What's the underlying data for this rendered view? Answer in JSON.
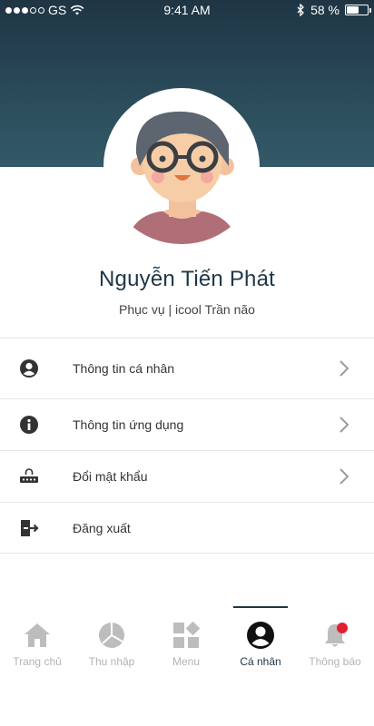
{
  "status_bar": {
    "carrier": "GS",
    "time": "9:41 AM",
    "battery": "58 %",
    "battery_level": 0.58,
    "icons": [
      "signal-dots",
      "wifi-icon",
      "bluetooth-icon",
      "battery-icon"
    ]
  },
  "profile": {
    "name": "Nguyễn Tiến Phát",
    "subtitle": "Phục vụ | icool Trần não"
  },
  "menu": {
    "items": [
      {
        "label": "Thông tin cá nhân",
        "icon": "user-circle-icon",
        "chevron": true
      },
      {
        "label": "Thông tin ứng dụng",
        "icon": "info-icon",
        "chevron": true
      },
      {
        "label": "Đổi mật khẩu",
        "icon": "password-icon",
        "chevron": true
      },
      {
        "label": "Đăng xuất",
        "icon": "logout-icon",
        "chevron": false
      }
    ]
  },
  "tabbar": {
    "tabs": [
      {
        "label": "Trang chủ",
        "icon": "home-icon"
      },
      {
        "label": "Thu nhập",
        "icon": "pie-chart-icon"
      },
      {
        "label": "Menu",
        "icon": "menu-grid-icon"
      },
      {
        "label": "Cá nhân",
        "icon": "user-circle-icon",
        "active": true
      },
      {
        "label": "Thông báo",
        "icon": "bell-icon",
        "badge": true
      }
    ]
  },
  "colors": {
    "header": "#2a4a59",
    "accent": "#1f3544",
    "inactive": "#b3b3b3",
    "badge": "#e0202e"
  }
}
